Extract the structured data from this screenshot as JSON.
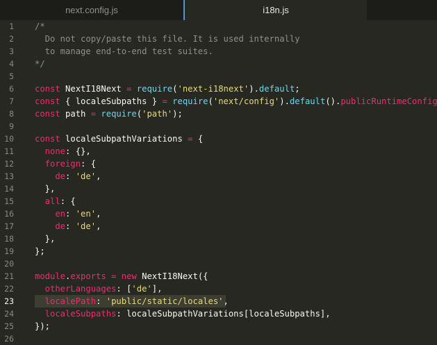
{
  "tabs": [
    {
      "label": "next.config.js",
      "active": false
    },
    {
      "label": "i18n.js",
      "active": true
    }
  ],
  "editor": {
    "current_line": 23,
    "lines": [
      {
        "n": "1",
        "segs": [
          {
            "t": "/*",
            "c": "c"
          }
        ]
      },
      {
        "n": "2",
        "segs": [
          {
            "t": "  Do not copy/paste this file. It is used internally",
            "c": "c"
          }
        ]
      },
      {
        "n": "3",
        "segs": [
          {
            "t": "  to manage end-to-end test suites.",
            "c": "c"
          }
        ]
      },
      {
        "n": "4",
        "segs": [
          {
            "t": "*/",
            "c": "c"
          }
        ]
      },
      {
        "n": "5",
        "segs": []
      },
      {
        "n": "6",
        "segs": [
          {
            "t": "const ",
            "c": "k"
          },
          {
            "t": "NextI18Next ",
            "c": "pl"
          },
          {
            "t": "= ",
            "c": "k"
          },
          {
            "t": "require",
            "c": "f"
          },
          {
            "t": "(",
            "c": "pl"
          },
          {
            "t": "'next-i18next'",
            "c": "s"
          },
          {
            "t": ").",
            "c": "pl"
          },
          {
            "t": "default",
            "c": "f"
          },
          {
            "t": ";",
            "c": "pl"
          }
        ]
      },
      {
        "n": "7",
        "segs": [
          {
            "t": "const ",
            "c": "k"
          },
          {
            "t": "{ localeSubpaths } ",
            "c": "pl"
          },
          {
            "t": "= ",
            "c": "k"
          },
          {
            "t": "require",
            "c": "f"
          },
          {
            "t": "(",
            "c": "pl"
          },
          {
            "t": "'next/config'",
            "c": "s"
          },
          {
            "t": ").",
            "c": "pl"
          },
          {
            "t": "default",
            "c": "f"
          },
          {
            "t": "().",
            "c": "pl"
          },
          {
            "t": "publicRuntimeConfig",
            "c": "k"
          },
          {
            "t": ";",
            "c": "pl"
          }
        ]
      },
      {
        "n": "8",
        "segs": [
          {
            "t": "const ",
            "c": "k"
          },
          {
            "t": "path ",
            "c": "pl"
          },
          {
            "t": "= ",
            "c": "k"
          },
          {
            "t": "require",
            "c": "f"
          },
          {
            "t": "(",
            "c": "pl"
          },
          {
            "t": "'path'",
            "c": "s"
          },
          {
            "t": ");",
            "c": "pl"
          }
        ]
      },
      {
        "n": "9",
        "segs": []
      },
      {
        "n": "10",
        "segs": [
          {
            "t": "const ",
            "c": "k"
          },
          {
            "t": "localeSubpathVariations ",
            "c": "pl"
          },
          {
            "t": "= ",
            "c": "k"
          },
          {
            "t": "{",
            "c": "pl"
          }
        ]
      },
      {
        "n": "11",
        "segs": [
          {
            "t": "  none",
            "c": "k"
          },
          {
            "t": ": {},",
            "c": "pl"
          }
        ]
      },
      {
        "n": "12",
        "segs": [
          {
            "t": "  foreign",
            "c": "k"
          },
          {
            "t": ": {",
            "c": "pl"
          }
        ]
      },
      {
        "n": "13",
        "segs": [
          {
            "t": "    de",
            "c": "k"
          },
          {
            "t": ": ",
            "c": "pl"
          },
          {
            "t": "'de'",
            "c": "s"
          },
          {
            "t": ",",
            "c": "pl"
          }
        ]
      },
      {
        "n": "14",
        "segs": [
          {
            "t": "  },",
            "c": "pl"
          }
        ]
      },
      {
        "n": "15",
        "segs": [
          {
            "t": "  all",
            "c": "k"
          },
          {
            "t": ": {",
            "c": "pl"
          }
        ]
      },
      {
        "n": "16",
        "segs": [
          {
            "t": "    en",
            "c": "k"
          },
          {
            "t": ": ",
            "c": "pl"
          },
          {
            "t": "'en'",
            "c": "s"
          },
          {
            "t": ",",
            "c": "pl"
          }
        ]
      },
      {
        "n": "17",
        "segs": [
          {
            "t": "    de",
            "c": "k"
          },
          {
            "t": ": ",
            "c": "pl"
          },
          {
            "t": "'de'",
            "c": "s"
          },
          {
            "t": ",",
            "c": "pl"
          }
        ]
      },
      {
        "n": "18",
        "segs": [
          {
            "t": "  },",
            "c": "pl"
          }
        ]
      },
      {
        "n": "19",
        "segs": [
          {
            "t": "};",
            "c": "pl"
          }
        ]
      },
      {
        "n": "20",
        "segs": []
      },
      {
        "n": "21",
        "segs": [
          {
            "t": "module",
            "c": "k"
          },
          {
            "t": ".",
            "c": "pl"
          },
          {
            "t": "exports ",
            "c": "k"
          },
          {
            "t": "= ",
            "c": "k"
          },
          {
            "t": "new ",
            "c": "k"
          },
          {
            "t": "NextI18Next",
            "c": "pl"
          },
          {
            "t": "({",
            "c": "pl"
          }
        ]
      },
      {
        "n": "22",
        "segs": [
          {
            "t": "  otherLanguages",
            "c": "k"
          },
          {
            "t": ": [",
            "c": "pl"
          },
          {
            "t": "'de'",
            "c": "s"
          },
          {
            "t": "],",
            "c": "pl"
          }
        ]
      },
      {
        "n": "23",
        "segs": [
          {
            "t": "  localePath",
            "c": "k"
          },
          {
            "t": ": ",
            "c": "pl"
          },
          {
            "t": "'public/static/locales'",
            "c": "s"
          },
          {
            "t": ",",
            "c": "pl"
          }
        ]
      },
      {
        "n": "24",
        "segs": [
          {
            "t": "  localeSubpaths",
            "c": "k"
          },
          {
            "t": ": localeSubpathVariations[localeSubpaths],",
            "c": "pl"
          }
        ]
      },
      {
        "n": "25",
        "segs": [
          {
            "t": "});",
            "c": "pl"
          }
        ]
      },
      {
        "n": "26",
        "segs": []
      }
    ]
  }
}
